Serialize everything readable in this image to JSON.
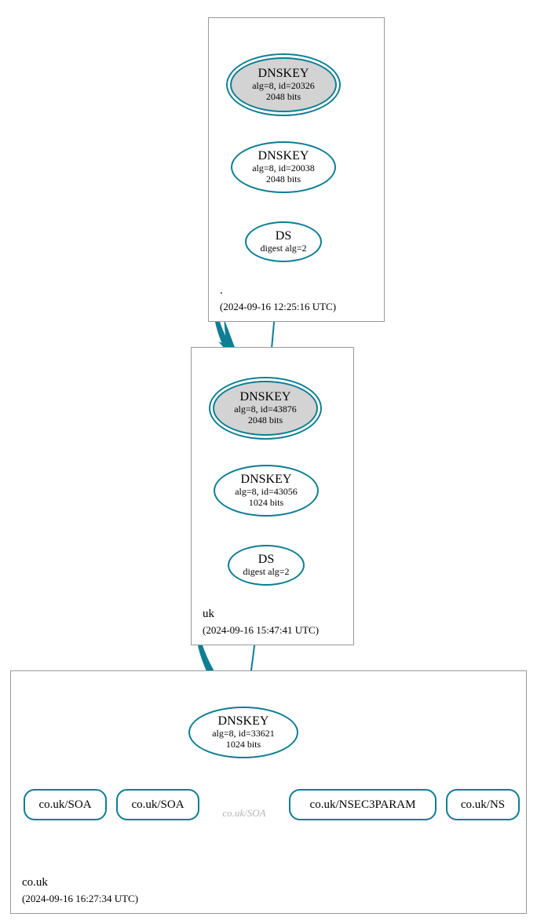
{
  "colors": {
    "accent": "#0d7e93",
    "ksk_fill": "#d3d3d3",
    "warn": "#c02020"
  },
  "zones": {
    "root": {
      "label": ".",
      "date": "(2024-09-16 12:25:16 UTC)"
    },
    "uk": {
      "label": "uk",
      "date": "(2024-09-16 15:47:41 UTC)"
    },
    "couk": {
      "label": "co.uk",
      "date": "(2024-09-16 16:27:34 UTC)"
    }
  },
  "nodes": {
    "root_ksk": {
      "title": "DNSKEY",
      "sub1": "alg=8, id=20326",
      "sub2": "2048 bits"
    },
    "root_zsk": {
      "title": "DNSKEY",
      "sub1": "alg=8, id=20038",
      "sub2": "2048 bits"
    },
    "root_ds": {
      "title": "DS",
      "sub1": "digest alg=2"
    },
    "uk_ksk": {
      "title": "DNSKEY",
      "sub1": "alg=8, id=43876",
      "sub2": "2048 bits"
    },
    "uk_zsk": {
      "title": "DNSKEY",
      "sub1": "alg=8, id=43056",
      "sub2": "1024 bits"
    },
    "uk_ds": {
      "title": "DS",
      "sub1": "digest alg=2"
    },
    "couk_key": {
      "title": "DNSKEY",
      "sub1": "alg=8, id=33621",
      "sub2": "1024 bits"
    },
    "leaf_soa1": {
      "label": "co.uk/SOA"
    },
    "leaf_soa2": {
      "label": "co.uk/SOA"
    },
    "leaf_soa_warn": {
      "label": "co.uk/SOA"
    },
    "leaf_nsec": {
      "label": "co.uk/NSEC3PARAM"
    },
    "leaf_ns": {
      "label": "co.uk/NS"
    }
  }
}
